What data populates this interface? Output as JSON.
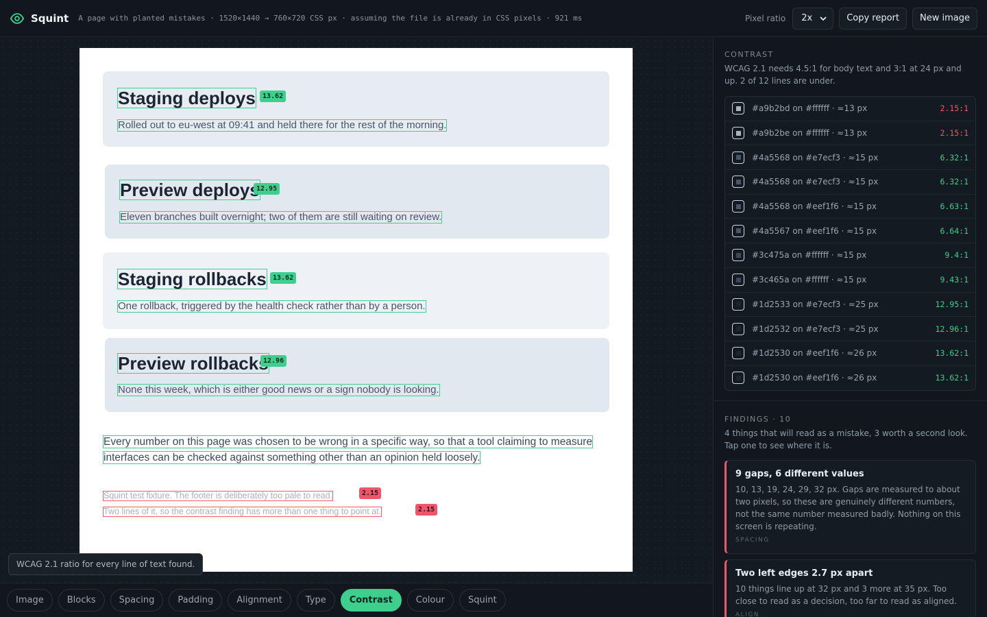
{
  "app": {
    "name": "Squint",
    "info": "A page with planted mistakes · 1520×1440 → 760×720 CSS px · assuming the file is already in CSS pixels · 921 ms"
  },
  "toolbar": {
    "pixel_ratio_label": "Pixel ratio",
    "pixel_ratio_value": "2x",
    "copy_report": "Copy report",
    "new_image": "New image"
  },
  "page": {
    "cards": [
      {
        "title": "Staging deploys",
        "ratio": "13.62",
        "body": "Rolled out to eu-west at 09:41 and held there for the rest of the morning."
      },
      {
        "title": "Preview deploys",
        "ratio": "12.95",
        "body": "Eleven branches built overnight; two of them are still waiting on review."
      },
      {
        "title": "Staging rollbacks",
        "ratio": "13.62",
        "body": "One rollback, triggered by the health check rather than by a person."
      },
      {
        "title": "Preview rollbacks",
        "ratio": "12.96",
        "body": "None this week, which is either good news or a sign nobody is looking."
      }
    ],
    "paragraph_1": "Every number on this page was chosen to be wrong in a specific way, so that a tool claiming to measure",
    "paragraph_2": "interfaces can be checked against something other than an opinion held loosely.",
    "footer_1": "Squint test fixture. The footer is deliberately too pale to read.",
    "footer_1_ratio": "2.15",
    "footer_2": "Two lines of it, so the contrast finding has more than one thing to point at.",
    "footer_2_ratio": "2.15"
  },
  "tooltip": "WCAG 2.1 ratio for every line of text found.",
  "tabs": [
    {
      "label": "Image",
      "active": false
    },
    {
      "label": "Blocks",
      "active": false
    },
    {
      "label": "Spacing",
      "active": false
    },
    {
      "label": "Padding",
      "active": false
    },
    {
      "label": "Alignment",
      "active": false
    },
    {
      "label": "Type",
      "active": false
    },
    {
      "label": "Contrast",
      "active": true
    },
    {
      "label": "Colour",
      "active": false
    },
    {
      "label": "Squint",
      "active": false
    }
  ],
  "contrast": {
    "title": "CONTRAST",
    "description": "WCAG 2.1 needs 4.5:1 for body text and 3:1 at 24 px and up. 2 of 12 lines are under.",
    "rows": [
      {
        "label": "#a9b2bd on #ffffff · ≈13 px",
        "value": "2.15:1",
        "status": "bad",
        "fg": "#a9b2bd"
      },
      {
        "label": "#a9b2be on #ffffff · ≈13 px",
        "value": "2.15:1",
        "status": "bad",
        "fg": "#a9b2be"
      },
      {
        "label": "#4a5568 on #e7ecf3 · ≈15 px",
        "value": "6.32:1",
        "status": "ok",
        "fg": "#4a5568"
      },
      {
        "label": "#4a5568 on #e7ecf3 · ≈15 px",
        "value": "6.32:1",
        "status": "ok",
        "fg": "#4a5568"
      },
      {
        "label": "#4a5568 on #eef1f6 · ≈15 px",
        "value": "6.63:1",
        "status": "ok",
        "fg": "#4a5568"
      },
      {
        "label": "#4a5567 on #eef1f6 · ≈15 px",
        "value": "6.64:1",
        "status": "ok",
        "fg": "#4a5567"
      },
      {
        "label": "#3c475a on #ffffff · ≈15 px",
        "value": "9.4:1",
        "status": "ok",
        "fg": "#3c475a"
      },
      {
        "label": "#3c465a on #ffffff · ≈15 px",
        "value": "9.43:1",
        "status": "ok",
        "fg": "#3c465a"
      },
      {
        "label": "#1d2533 on #e7ecf3 · ≈25 px",
        "value": "12.95:1",
        "status": "ok",
        "fg": "#1d2533"
      },
      {
        "label": "#1d2532 on #e7ecf3 · ≈25 px",
        "value": "12.96:1",
        "status": "ok",
        "fg": "#1d2532"
      },
      {
        "label": "#1d2530 on #eef1f6 · ≈26 px",
        "value": "13.62:1",
        "status": "ok",
        "fg": "#1d2530"
      },
      {
        "label": "#1d2530 on #eef1f6 · ≈26 px",
        "value": "13.62:1",
        "status": "ok",
        "fg": "#1d2530"
      }
    ]
  },
  "findings": {
    "title": "FINDINGS · 10",
    "description": "4 things that will read as a mistake, 3 worth a second look. Tap one to see where it is.",
    "items": [
      {
        "title": "9 gaps, 6 different values",
        "body": "10, 13, 19, 24, 29, 32 px. Gaps are measured to about two pixels, so these are genuinely different numbers, not the same number measured badly. Nothing on this screen is repeating.",
        "tag": "SPACING"
      },
      {
        "title": "Two left edges 2.7 px apart",
        "body": "10 things line up at 32 px and 3 more at 35 px. Too close to read as a decision, too far to read as aligned.",
        "tag": "ALIGN"
      }
    ]
  },
  "colors": {
    "accent": "#3ecf8e",
    "danger": "#f0566b",
    "background": "#0f1419"
  }
}
